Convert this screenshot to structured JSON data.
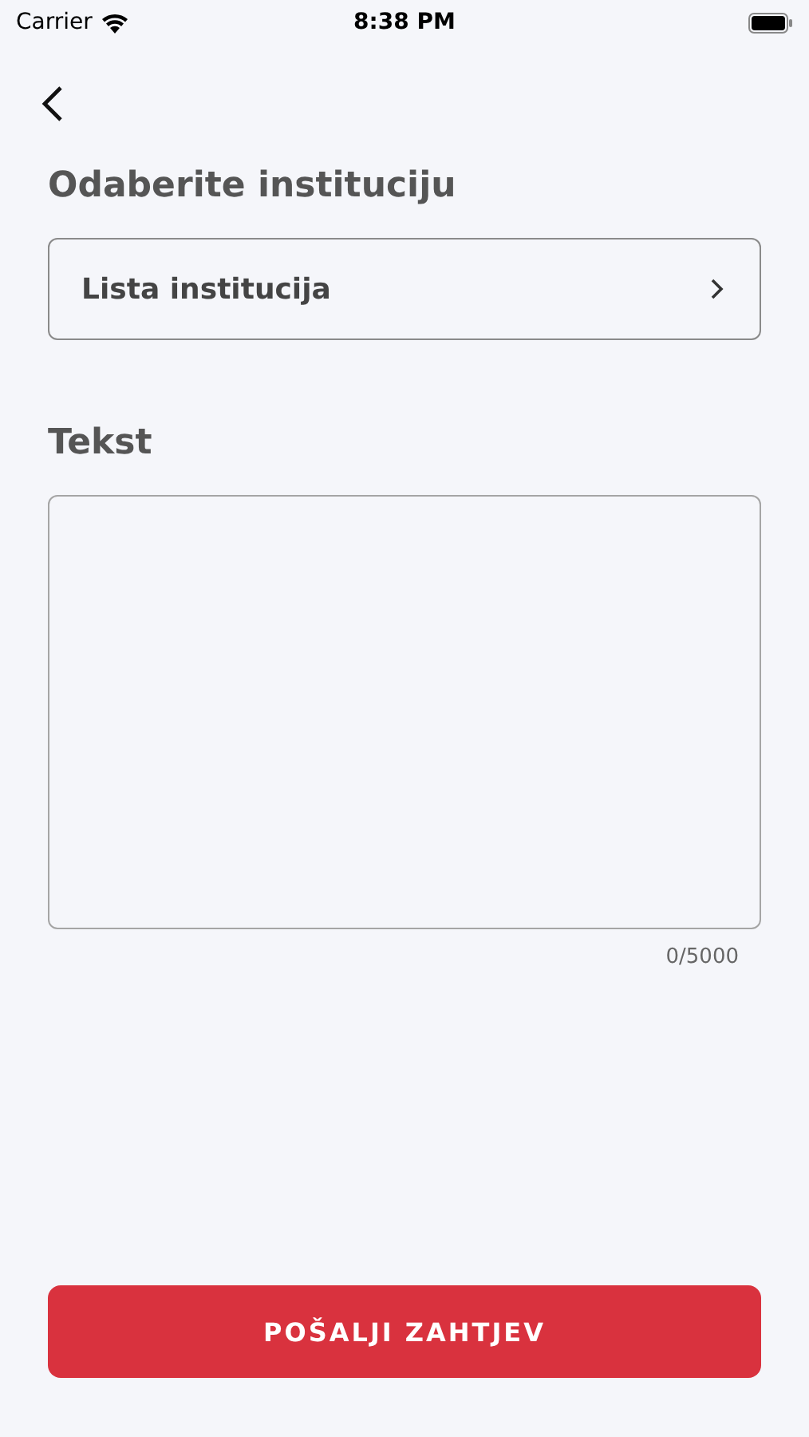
{
  "status_bar": {
    "carrier": "Carrier",
    "time": "8:38 PM"
  },
  "institution": {
    "heading": "Odaberite instituciju",
    "select_label": "Lista institucija"
  },
  "text": {
    "heading": "Tekst",
    "counter": "0/5000"
  },
  "submit_button": "POŠALJI ZAHTJEV"
}
